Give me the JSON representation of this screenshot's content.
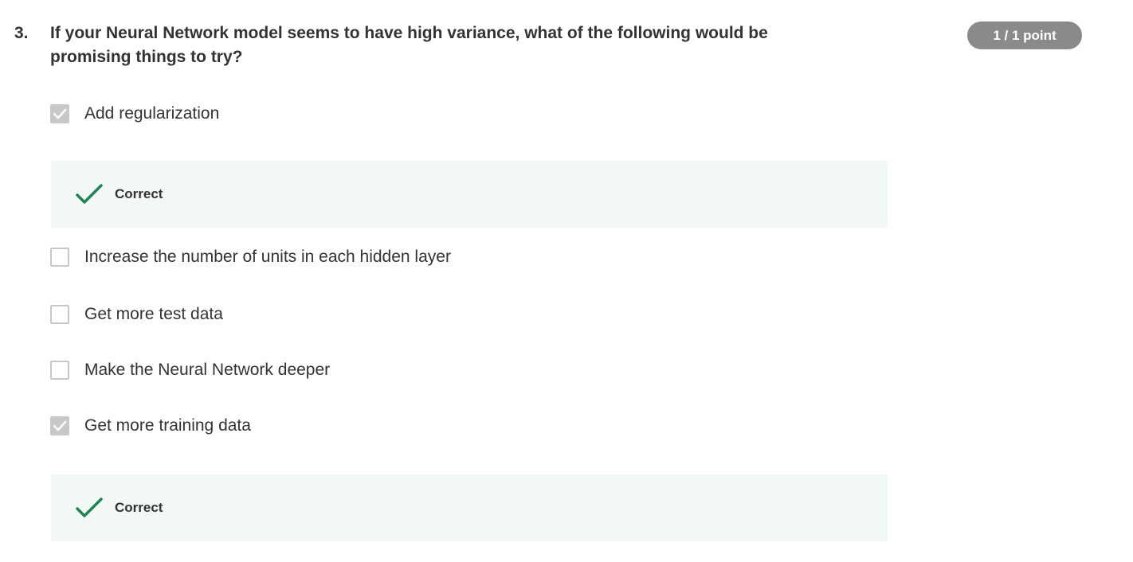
{
  "question": {
    "number": "3.",
    "text": "If your Neural Network model seems to have high variance, what of the following would be promising things to try?",
    "score": "1 / 1 point"
  },
  "options": [
    {
      "label": "Add regularization",
      "checked": true,
      "feedback": "Correct"
    },
    {
      "label": "Increase the number of units in each hidden layer",
      "checked": false
    },
    {
      "label": "Get more test data",
      "checked": false
    },
    {
      "label": "Make the Neural Network deeper",
      "checked": false
    },
    {
      "label": "Get more training data",
      "checked": true,
      "feedback": "Correct"
    }
  ],
  "colors": {
    "correct_accent": "#1f8354",
    "feedback_background": "#f2f8f6",
    "checkbox_checked": "#c8c8c8",
    "badge_background": "#8a8a8a"
  }
}
